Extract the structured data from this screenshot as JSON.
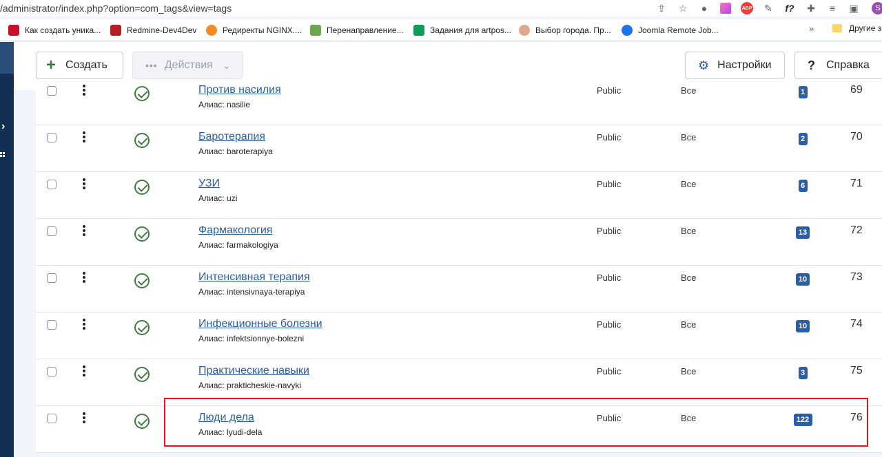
{
  "browser": {
    "address": "/administrator/index.php?option=com_tags&view=tags",
    "bookmarks": [
      {
        "label": "Как создать уника...",
        "color": "#c8102e"
      },
      {
        "label": "Redmine-Dev4Dev",
        "color": "#b32024"
      },
      {
        "label": "Редиректы NGINX....",
        "color": "#f28b24"
      },
      {
        "label": "Перенаправление...",
        "color": "#6aa84f"
      },
      {
        "label": "Задания для artpos...",
        "color": "#0f9d58"
      },
      {
        "label": "Выбор города. Пр...",
        "color": "#e0a88a"
      },
      {
        "label": "Joomla Remote Job...",
        "color": "#1a73e8"
      }
    ],
    "more": "»",
    "other_bookmarks": "Другие за",
    "profile_initial": "S"
  },
  "toolbar": {
    "create_label": "Создать",
    "actions_label": "Действия",
    "settings_label": "Настройки",
    "help_label": "Справка"
  },
  "rows": [
    {
      "title": "Против насилия",
      "alias": "Алиас: nasilie",
      "access": "Public",
      "language": "Все",
      "count": "1",
      "id": "69"
    },
    {
      "title": "Баротерапия",
      "alias": "Алиас: baroterapiya",
      "access": "Public",
      "language": "Все",
      "count": "2",
      "id": "70"
    },
    {
      "title": "УЗИ",
      "alias": "Алиас: uzi",
      "access": "Public",
      "language": "Все",
      "count": "6",
      "id": "71"
    },
    {
      "title": "Фармакология",
      "alias": "Алиас: farmakologiya",
      "access": "Public",
      "language": "Все",
      "count": "13",
      "id": "72"
    },
    {
      "title": "Интенсивная терапия",
      "alias": "Алиас: intensivnaya-terapiya",
      "access": "Public",
      "language": "Все",
      "count": "10",
      "id": "73"
    },
    {
      "title": "Инфекционные болезни",
      "alias": "Алиас: infektsionnye-bolezni",
      "access": "Public",
      "language": "Все",
      "count": "10",
      "id": "74"
    },
    {
      "title": "Практические навыки",
      "alias": "Алиас: prakticheskie-navyki",
      "access": "Public",
      "language": "Все",
      "count": "3",
      "id": "75"
    },
    {
      "title": "Люди дела",
      "alias": "Алиас: lyudi-dela",
      "access": "Public",
      "language": "Все",
      "count": "122",
      "id": "76"
    }
  ],
  "colors": {
    "accent": "#2a5ea6",
    "published": "#3e7c3f",
    "highlight": "#e8141c",
    "sidebar": "#132f53"
  }
}
